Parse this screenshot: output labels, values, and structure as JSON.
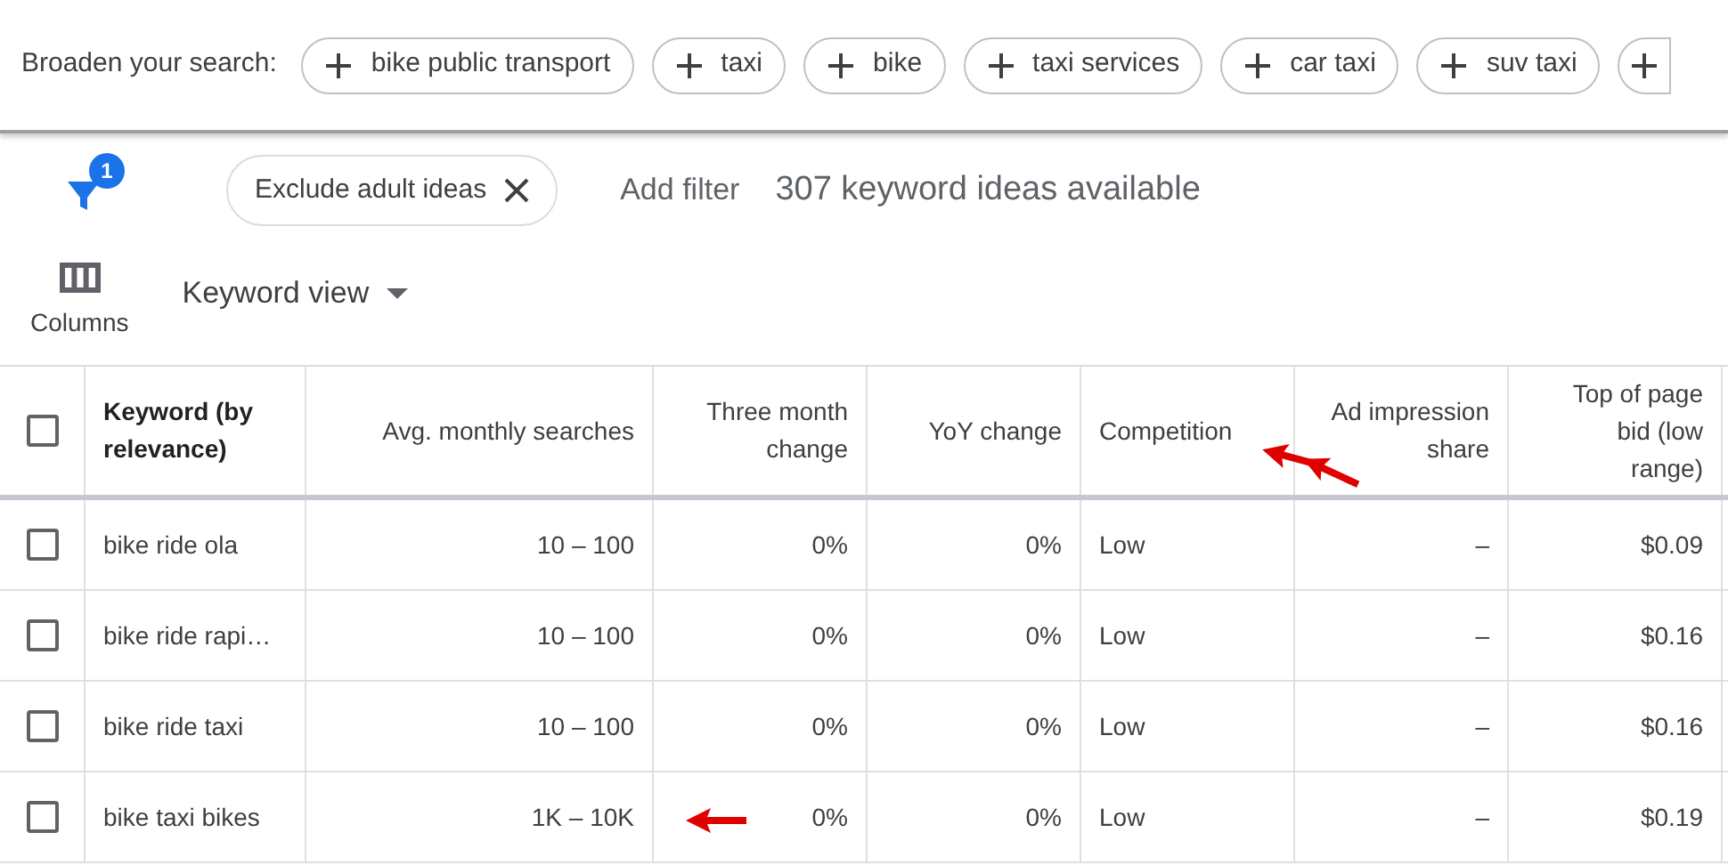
{
  "broaden": {
    "label": "Broaden your search:",
    "chips": [
      "bike public transport",
      "taxi",
      "bike",
      "taxi services",
      "car taxi",
      "suv taxi"
    ]
  },
  "filters": {
    "badge": "1",
    "chips": [
      {
        "label": "Exclude adult ideas"
      }
    ],
    "add_filter": "Add filter",
    "summary": "307 keyword ideas available"
  },
  "toolbar": {
    "columns": "Columns",
    "view": "Keyword view"
  },
  "table": {
    "select_all_checked": false,
    "columns": [
      "Keyword (by relevance)",
      "Avg. monthly searches",
      "Three month change",
      "YoY change",
      "Competition",
      "Ad impression share",
      "Top of page bid (low range)"
    ],
    "rows": [
      {
        "checked": false,
        "cells": [
          "bike ride ola",
          "10 – 100",
          "0%",
          "0%",
          "Low",
          "–",
          "$0.09"
        ]
      },
      {
        "checked": false,
        "cells": [
          "bike ride rapi…",
          "10 – 100",
          "0%",
          "0%",
          "Low",
          "–",
          "$0.16"
        ]
      },
      {
        "checked": false,
        "cells": [
          "bike ride taxi",
          "10 – 100",
          "0%",
          "0%",
          "Low",
          "–",
          "$0.16"
        ]
      },
      {
        "checked": false,
        "cells": [
          "bike taxi bikes",
          "1K – 10K",
          "0%",
          "0%",
          "Low",
          "–",
          "$0.19"
        ]
      }
    ]
  }
}
